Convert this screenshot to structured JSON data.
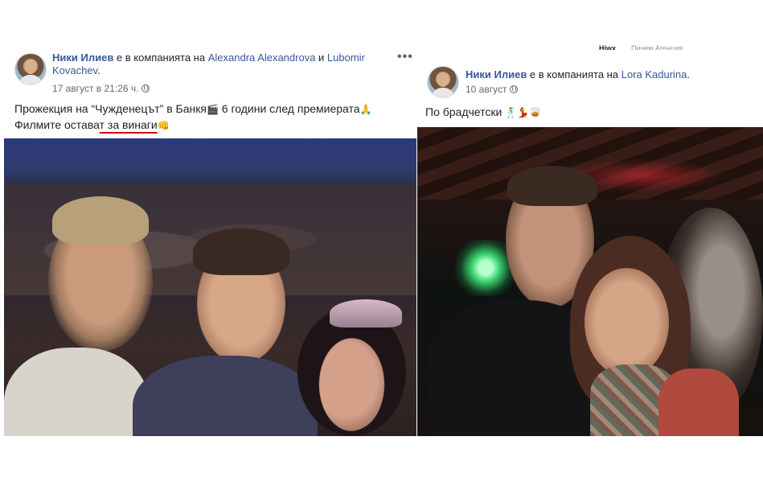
{
  "left_post": {
    "author": "Ники Илиев",
    "connector": " е в компанията на ",
    "tagged_1": "Alexandra Alexandrova",
    "and": " и ",
    "tagged_2": "Lubomir Kovachev",
    "end": ".",
    "timestamp": "17 август в 21:26 ч.",
    "more": "•••",
    "text_line1_a": "Прожекция на “Чужденецът” в Банкя",
    "text_line1_emoji1": "🎬",
    "text_line1_b": " 6 години след премиерата",
    "text_line1_emoji2": "🙏",
    "text_line2_a": "Филмите остава",
    "text_line2_b": "т за винаги",
    "text_line2_emoji": "👊"
  },
  "right_post": {
    "author": "Ники Илиев",
    "connector": " е в компанията на ",
    "tagged_1": "Lora Kadurina",
    "end": ".",
    "timestamp": "10 август",
    "text": "По брадчетски ",
    "emojis": "🕺💃🥃",
    "strip_text_1": "Hiwx",
    "strip_text_2": "Пичим Агенция"
  },
  "icons": {
    "globe": "globe-icon",
    "more": "more-options-icon"
  }
}
